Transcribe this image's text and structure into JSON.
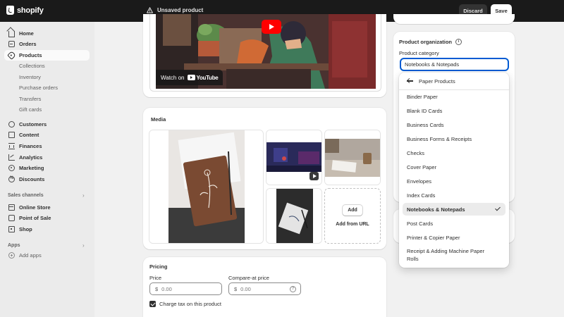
{
  "topbar": {
    "brand": "shopify",
    "status": "Unsaved product",
    "discard_label": "Discard",
    "save_label": "Save"
  },
  "sidebar": {
    "items": [
      {
        "label": "Home",
        "icon": "home-icon"
      },
      {
        "label": "Orders",
        "icon": "orders-icon"
      },
      {
        "label": "Products",
        "icon": "tag-icon",
        "active": true
      },
      {
        "label": "Customers",
        "icon": "person-icon"
      },
      {
        "label": "Content",
        "icon": "content-icon"
      },
      {
        "label": "Finances",
        "icon": "bank-icon"
      },
      {
        "label": "Analytics",
        "icon": "chart-icon"
      },
      {
        "label": "Marketing",
        "icon": "target-icon"
      },
      {
        "label": "Discounts",
        "icon": "discount-icon"
      }
    ],
    "product_sub_items": [
      "Collections",
      "Inventory",
      "Purchase orders",
      "Transfers",
      "Gift cards"
    ],
    "sales_channels_label": "Sales channels",
    "sales_channels": [
      {
        "label": "Online Store",
        "icon": "store-icon"
      },
      {
        "label": "Point of Sale",
        "icon": "pos-icon"
      },
      {
        "label": "Shop",
        "icon": "shop-icon"
      }
    ],
    "apps_label": "Apps",
    "add_apps_label": "Add apps"
  },
  "video": {
    "watch_on": "Watch on",
    "youtube": "YouTube"
  },
  "media": {
    "title": "Media",
    "add_label": "Add",
    "add_from_url": "Add from URL"
  },
  "pricing": {
    "title": "Pricing",
    "price_label": "Price",
    "compare_label": "Compare-at price",
    "currency": "$",
    "price_placeholder": "0.00",
    "compare_placeholder": "0.00",
    "tax_label": "Charge tax on this product",
    "tax_checked": true
  },
  "organization": {
    "title": "Product organization",
    "category_label": "Product category",
    "category_value": "Notebooks & Notepads"
  },
  "dropdown": {
    "back_label": "Paper Products",
    "options": [
      "Binder Paper",
      "Blank ID Cards",
      "Business Cards",
      "Business Forms & Receipts",
      "Checks",
      "Cover Paper",
      "Envelopes",
      "Index Cards",
      "Notebooks & Notepads",
      "Post Cards",
      "Printer & Copier Paper",
      "Receipt & Adding Machine Paper Rolls"
    ],
    "selected": "Notebooks & Notepads"
  },
  "colors": {
    "topbar_bg": "#1a1a1a",
    "focus_blue": "#005bd3",
    "youtube_red": "#ff0000"
  }
}
